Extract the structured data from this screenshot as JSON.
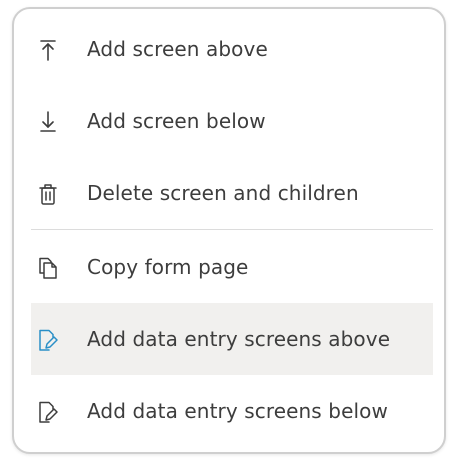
{
  "menu": {
    "items": [
      {
        "label": "Add screen above",
        "icon": "arrow-up-to-line-icon"
      },
      {
        "label": "Add screen below",
        "icon": "arrow-down-to-line-icon"
      },
      {
        "label": "Delete screen and children",
        "icon": "trash-icon"
      },
      {
        "label": "Copy form page",
        "icon": "copy-page-icon"
      },
      {
        "label": "Add data entry screens above",
        "icon": "page-edit-icon",
        "highlighted": true
      },
      {
        "label": "Add data entry screens below",
        "icon": "page-edit-icon"
      }
    ]
  },
  "colors": {
    "text": "#3d3d3d",
    "highlight_bg": "#f1f0ee",
    "active_icon": "#2a8fc7",
    "border": "#cfcfcf"
  }
}
